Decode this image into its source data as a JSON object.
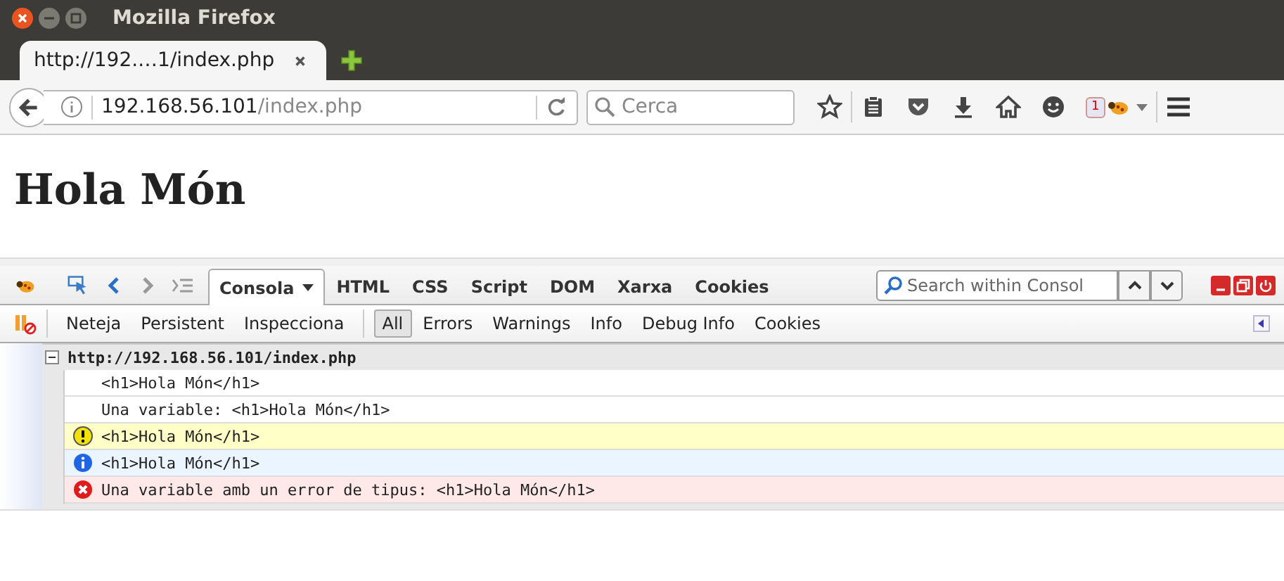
{
  "window": {
    "title": "Mozilla Firefox"
  },
  "tabs": [
    {
      "title": "http://192.…1/index.php",
      "selected": true
    }
  ],
  "address": {
    "host": "192.168.56.101",
    "path": "/index.php"
  },
  "search": {
    "placeholder": "Cerca"
  },
  "toolbar_badge": "1",
  "page": {
    "heading": "Hola Món"
  },
  "devtools": {
    "panels": [
      {
        "label": "Consola",
        "selected": true,
        "dropdown": true
      },
      {
        "label": "HTML",
        "selected": false,
        "dropdown": false
      },
      {
        "label": "CSS",
        "selected": false,
        "dropdown": false
      },
      {
        "label": "Script",
        "selected": false,
        "dropdown": false
      },
      {
        "label": "DOM",
        "selected": false,
        "dropdown": false
      },
      {
        "label": "Xarxa",
        "selected": false,
        "dropdown": false
      },
      {
        "label": "Cookies",
        "selected": false,
        "dropdown": false
      }
    ],
    "search": {
      "placeholder": "Search within Consol"
    },
    "commands": [
      "Neteja",
      "Persistent",
      "Inspecciona"
    ],
    "filters": [
      {
        "label": "All",
        "selected": true
      },
      {
        "label": "Errors",
        "selected": false
      },
      {
        "label": "Warnings",
        "selected": false
      },
      {
        "label": "Info",
        "selected": false
      },
      {
        "label": "Debug Info",
        "selected": false
      },
      {
        "label": "Cookies",
        "selected": false
      }
    ],
    "log_group": {
      "url": "http://192.168.56.101/index.php",
      "expanded": true,
      "entries": [
        {
          "kind": "log",
          "text": "<h1>Hola Món</h1>"
        },
        {
          "kind": "log",
          "text": "Una variable: <h1>Hola Món</h1>"
        },
        {
          "kind": "warning",
          "text": "<h1>Hola Món</h1>"
        },
        {
          "kind": "info",
          "text": "<h1>Hola Món</h1>"
        },
        {
          "kind": "error",
          "text": "Una variable amb un error de tipus: <h1>Hola Món</h1>"
        }
      ]
    }
  }
}
